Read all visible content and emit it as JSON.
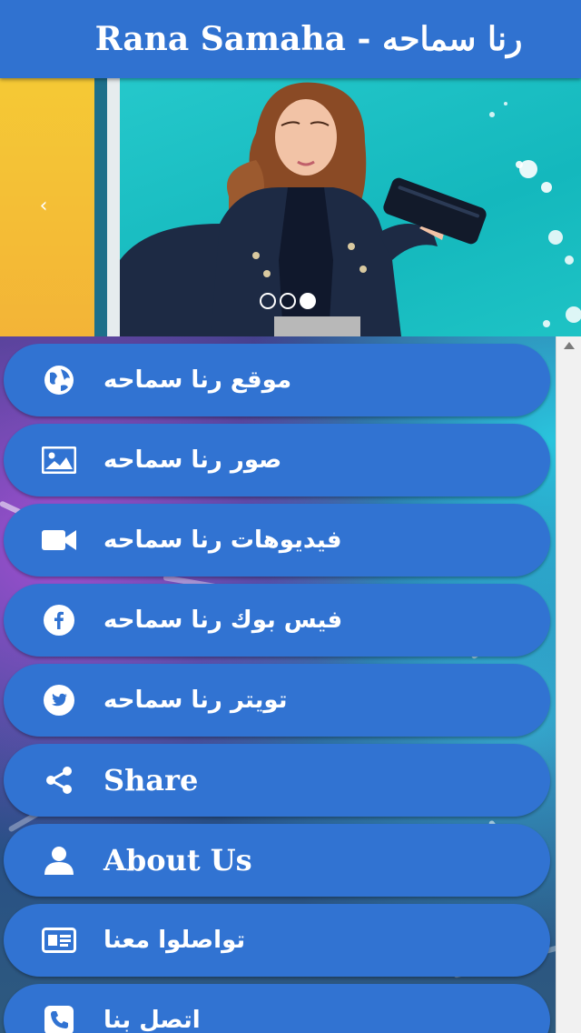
{
  "header": {
    "title": "Rana Samaha - رنا سماحه"
  },
  "slider": {
    "prev_glyph": "‹",
    "dots_count": 3,
    "active_dot": 3
  },
  "menu": {
    "items": [
      {
        "label": "موقع رنا سماحه",
        "icon": "globe-icon",
        "lang": "ar"
      },
      {
        "label": "صور رنا سماحه",
        "icon": "image-icon",
        "lang": "ar"
      },
      {
        "label": "فيديوهات رنا سماحه",
        "icon": "video-camera-icon",
        "lang": "ar"
      },
      {
        "label": "فيس بوك رنا سماحه",
        "icon": "facebook-icon",
        "lang": "ar"
      },
      {
        "label": "تويتر رنا سماحه",
        "icon": "twitter-icon",
        "lang": "ar"
      },
      {
        "label": "Share",
        "icon": "share-icon",
        "lang": "en"
      },
      {
        "label": "About Us",
        "icon": "user-icon",
        "lang": "en"
      },
      {
        "label": "تواصلوا معنا",
        "icon": "contact-card-icon",
        "lang": "ar"
      },
      {
        "label": "اتصل بنا",
        "icon": "phone-icon",
        "lang": "ar"
      }
    ]
  },
  "colors": {
    "header_bg": "#3072d0",
    "button_bg": "#3173d2",
    "text": "#ffffff"
  }
}
